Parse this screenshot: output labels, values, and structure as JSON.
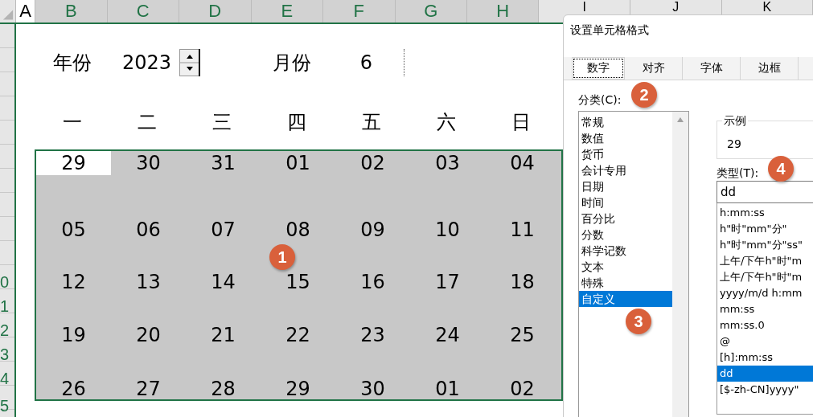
{
  "sheet": {
    "columns": [
      "A",
      "B",
      "C",
      "D",
      "E",
      "F",
      "G",
      "H"
    ],
    "columns_behind_dialog": [
      "I",
      "J",
      "K"
    ],
    "row_numbers": [
      "0",
      "1",
      "2",
      "3",
      "4",
      "5"
    ],
    "year_label": "年份",
    "year_value": "2023",
    "month_label": "月份",
    "month_value": "6",
    "weekdays": [
      "一",
      "二",
      "三",
      "四",
      "五",
      "六",
      "日"
    ],
    "weeks": [
      [
        {
          "day": "29",
          "selected": true
        },
        {
          "day": "30",
          "selected": false
        },
        {
          "day": "31",
          "selected": false
        },
        {
          "day": "01",
          "selected": false
        },
        {
          "day": "02",
          "selected": false
        },
        {
          "day": "03",
          "selected": false
        },
        {
          "day": "04",
          "selected": false
        }
      ],
      [
        {
          "day": "05",
          "selected": false
        },
        {
          "day": "06",
          "selected": false
        },
        {
          "day": "07",
          "selected": false
        },
        {
          "day": "08",
          "selected": false
        },
        {
          "day": "09",
          "selected": false
        },
        {
          "day": "10",
          "selected": false
        },
        {
          "day": "11",
          "selected": false
        }
      ],
      [
        {
          "day": "12",
          "selected": false
        },
        {
          "day": "13",
          "selected": false
        },
        {
          "day": "14",
          "selected": false
        },
        {
          "day": "15",
          "selected": false
        },
        {
          "day": "16",
          "selected": false
        },
        {
          "day": "17",
          "selected": false
        },
        {
          "day": "18",
          "selected": false
        }
      ],
      [
        {
          "day": "19",
          "selected": false
        },
        {
          "day": "20",
          "selected": false
        },
        {
          "day": "21",
          "selected": false
        },
        {
          "day": "22",
          "selected": false
        },
        {
          "day": "23",
          "selected": false
        },
        {
          "day": "24",
          "selected": false
        },
        {
          "day": "25",
          "selected": false
        }
      ],
      [
        {
          "day": "26",
          "selected": false
        },
        {
          "day": "27",
          "selected": false
        },
        {
          "day": "28",
          "selected": false
        },
        {
          "day": "29",
          "selected": false
        },
        {
          "day": "30",
          "selected": false
        },
        {
          "day": "01",
          "selected": false
        },
        {
          "day": "02",
          "selected": false
        }
      ]
    ]
  },
  "dialog": {
    "title": "设置单元格格式",
    "tabs": [
      {
        "label": "数字",
        "selected": true
      },
      {
        "label": "对齐",
        "selected": false
      },
      {
        "label": "字体",
        "selected": false
      },
      {
        "label": "边框",
        "selected": false
      }
    ],
    "category_label": "分类(C):",
    "categories": [
      {
        "label": "常规",
        "selected": false
      },
      {
        "label": "数值",
        "selected": false
      },
      {
        "label": "货币",
        "selected": false
      },
      {
        "label": "会计专用",
        "selected": false
      },
      {
        "label": "日期",
        "selected": false
      },
      {
        "label": "时间",
        "selected": false
      },
      {
        "label": "百分比",
        "selected": false
      },
      {
        "label": "分数",
        "selected": false
      },
      {
        "label": "科学记数",
        "selected": false
      },
      {
        "label": "文本",
        "selected": false
      },
      {
        "label": "特殊",
        "selected": false
      },
      {
        "label": "自定义",
        "selected": true
      }
    ],
    "sample_label": "示例",
    "sample_value": "29",
    "type_label": "类型(T):",
    "type_value": "dd",
    "formats": [
      {
        "label": "h:mm:ss",
        "selected": false
      },
      {
        "label": "h\"时\"mm\"分\"",
        "selected": false
      },
      {
        "label": "h\"时\"mm\"分\"ss\"",
        "selected": false
      },
      {
        "label": "上午/下午h\"时\"m",
        "selected": false
      },
      {
        "label": "上午/下午h\"时\"m",
        "selected": false
      },
      {
        "label": "yyyy/m/d h:mm",
        "selected": false
      },
      {
        "label": "mm:ss",
        "selected": false
      },
      {
        "label": "mm:ss.0",
        "selected": false
      },
      {
        "label": "@",
        "selected": false
      },
      {
        "label": "[h]:mm:ss",
        "selected": false
      },
      {
        "label": "dd",
        "selected": true
      },
      {
        "label": "[$-zh-CN]yyyy\"",
        "selected": false
      }
    ]
  },
  "step_badges": [
    "1",
    "2",
    "3",
    "4"
  ]
}
